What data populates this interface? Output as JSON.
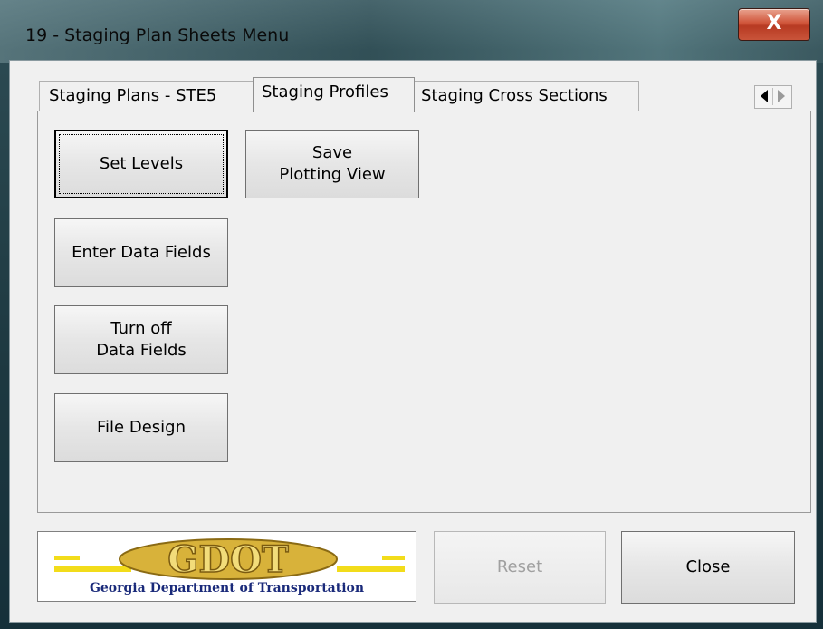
{
  "window": {
    "title": "19 - Staging Plan Sheets Menu",
    "close_glyph": "X"
  },
  "tabs": [
    {
      "label": "Staging Plans - STE5",
      "active": false
    },
    {
      "label": "Staging Profiles",
      "active": true
    },
    {
      "label": "Staging Cross Sections",
      "active": false
    }
  ],
  "tab_scroll": {
    "left_icon": "arrow-left-icon",
    "right_icon": "arrow-right-icon"
  },
  "panel_buttons": {
    "set_levels": "Set Levels",
    "save_plotting_view": "Save\nPlotting View",
    "enter_data_fields": "Enter Data Fields",
    "turn_off_data_fields": "Turn off\nData Fields",
    "file_design": "File Design"
  },
  "footer": {
    "logo_text": "GDOT",
    "logo_caption": "Georgia Department of Transportation",
    "reset_label": "Reset",
    "close_label": "Close"
  },
  "colors": {
    "logo_gold": "#d8b23a",
    "logo_yellow": "#f2dc1a",
    "logo_navy": "#1a2a7a"
  }
}
